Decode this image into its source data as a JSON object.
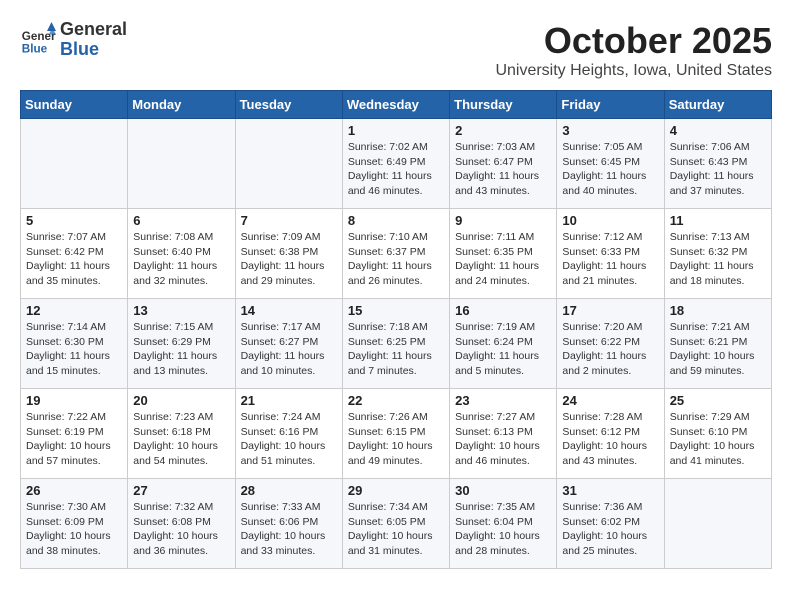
{
  "header": {
    "logo_general": "General",
    "logo_blue": "Blue",
    "month_title": "October 2025",
    "location": "University Heights, Iowa, United States"
  },
  "days_of_week": [
    "Sunday",
    "Monday",
    "Tuesday",
    "Wednesday",
    "Thursday",
    "Friday",
    "Saturday"
  ],
  "weeks": [
    [
      {
        "day": "",
        "info": ""
      },
      {
        "day": "",
        "info": ""
      },
      {
        "day": "",
        "info": ""
      },
      {
        "day": "1",
        "info": "Sunrise: 7:02 AM\nSunset: 6:49 PM\nDaylight: 11 hours\nand 46 minutes."
      },
      {
        "day": "2",
        "info": "Sunrise: 7:03 AM\nSunset: 6:47 PM\nDaylight: 11 hours\nand 43 minutes."
      },
      {
        "day": "3",
        "info": "Sunrise: 7:05 AM\nSunset: 6:45 PM\nDaylight: 11 hours\nand 40 minutes."
      },
      {
        "day": "4",
        "info": "Sunrise: 7:06 AM\nSunset: 6:43 PM\nDaylight: 11 hours\nand 37 minutes."
      }
    ],
    [
      {
        "day": "5",
        "info": "Sunrise: 7:07 AM\nSunset: 6:42 PM\nDaylight: 11 hours\nand 35 minutes."
      },
      {
        "day": "6",
        "info": "Sunrise: 7:08 AM\nSunset: 6:40 PM\nDaylight: 11 hours\nand 32 minutes."
      },
      {
        "day": "7",
        "info": "Sunrise: 7:09 AM\nSunset: 6:38 PM\nDaylight: 11 hours\nand 29 minutes."
      },
      {
        "day": "8",
        "info": "Sunrise: 7:10 AM\nSunset: 6:37 PM\nDaylight: 11 hours\nand 26 minutes."
      },
      {
        "day": "9",
        "info": "Sunrise: 7:11 AM\nSunset: 6:35 PM\nDaylight: 11 hours\nand 24 minutes."
      },
      {
        "day": "10",
        "info": "Sunrise: 7:12 AM\nSunset: 6:33 PM\nDaylight: 11 hours\nand 21 minutes."
      },
      {
        "day": "11",
        "info": "Sunrise: 7:13 AM\nSunset: 6:32 PM\nDaylight: 11 hours\nand 18 minutes."
      }
    ],
    [
      {
        "day": "12",
        "info": "Sunrise: 7:14 AM\nSunset: 6:30 PM\nDaylight: 11 hours\nand 15 minutes."
      },
      {
        "day": "13",
        "info": "Sunrise: 7:15 AM\nSunset: 6:29 PM\nDaylight: 11 hours\nand 13 minutes."
      },
      {
        "day": "14",
        "info": "Sunrise: 7:17 AM\nSunset: 6:27 PM\nDaylight: 11 hours\nand 10 minutes."
      },
      {
        "day": "15",
        "info": "Sunrise: 7:18 AM\nSunset: 6:25 PM\nDaylight: 11 hours\nand 7 minutes."
      },
      {
        "day": "16",
        "info": "Sunrise: 7:19 AM\nSunset: 6:24 PM\nDaylight: 11 hours\nand 5 minutes."
      },
      {
        "day": "17",
        "info": "Sunrise: 7:20 AM\nSunset: 6:22 PM\nDaylight: 11 hours\nand 2 minutes."
      },
      {
        "day": "18",
        "info": "Sunrise: 7:21 AM\nSunset: 6:21 PM\nDaylight: 10 hours\nand 59 minutes."
      }
    ],
    [
      {
        "day": "19",
        "info": "Sunrise: 7:22 AM\nSunset: 6:19 PM\nDaylight: 10 hours\nand 57 minutes."
      },
      {
        "day": "20",
        "info": "Sunrise: 7:23 AM\nSunset: 6:18 PM\nDaylight: 10 hours\nand 54 minutes."
      },
      {
        "day": "21",
        "info": "Sunrise: 7:24 AM\nSunset: 6:16 PM\nDaylight: 10 hours\nand 51 minutes."
      },
      {
        "day": "22",
        "info": "Sunrise: 7:26 AM\nSunset: 6:15 PM\nDaylight: 10 hours\nand 49 minutes."
      },
      {
        "day": "23",
        "info": "Sunrise: 7:27 AM\nSunset: 6:13 PM\nDaylight: 10 hours\nand 46 minutes."
      },
      {
        "day": "24",
        "info": "Sunrise: 7:28 AM\nSunset: 6:12 PM\nDaylight: 10 hours\nand 43 minutes."
      },
      {
        "day": "25",
        "info": "Sunrise: 7:29 AM\nSunset: 6:10 PM\nDaylight: 10 hours\nand 41 minutes."
      }
    ],
    [
      {
        "day": "26",
        "info": "Sunrise: 7:30 AM\nSunset: 6:09 PM\nDaylight: 10 hours\nand 38 minutes."
      },
      {
        "day": "27",
        "info": "Sunrise: 7:32 AM\nSunset: 6:08 PM\nDaylight: 10 hours\nand 36 minutes."
      },
      {
        "day": "28",
        "info": "Sunrise: 7:33 AM\nSunset: 6:06 PM\nDaylight: 10 hours\nand 33 minutes."
      },
      {
        "day": "29",
        "info": "Sunrise: 7:34 AM\nSunset: 6:05 PM\nDaylight: 10 hours\nand 31 minutes."
      },
      {
        "day": "30",
        "info": "Sunrise: 7:35 AM\nSunset: 6:04 PM\nDaylight: 10 hours\nand 28 minutes."
      },
      {
        "day": "31",
        "info": "Sunrise: 7:36 AM\nSunset: 6:02 PM\nDaylight: 10 hours\nand 25 minutes."
      },
      {
        "day": "",
        "info": ""
      }
    ]
  ]
}
